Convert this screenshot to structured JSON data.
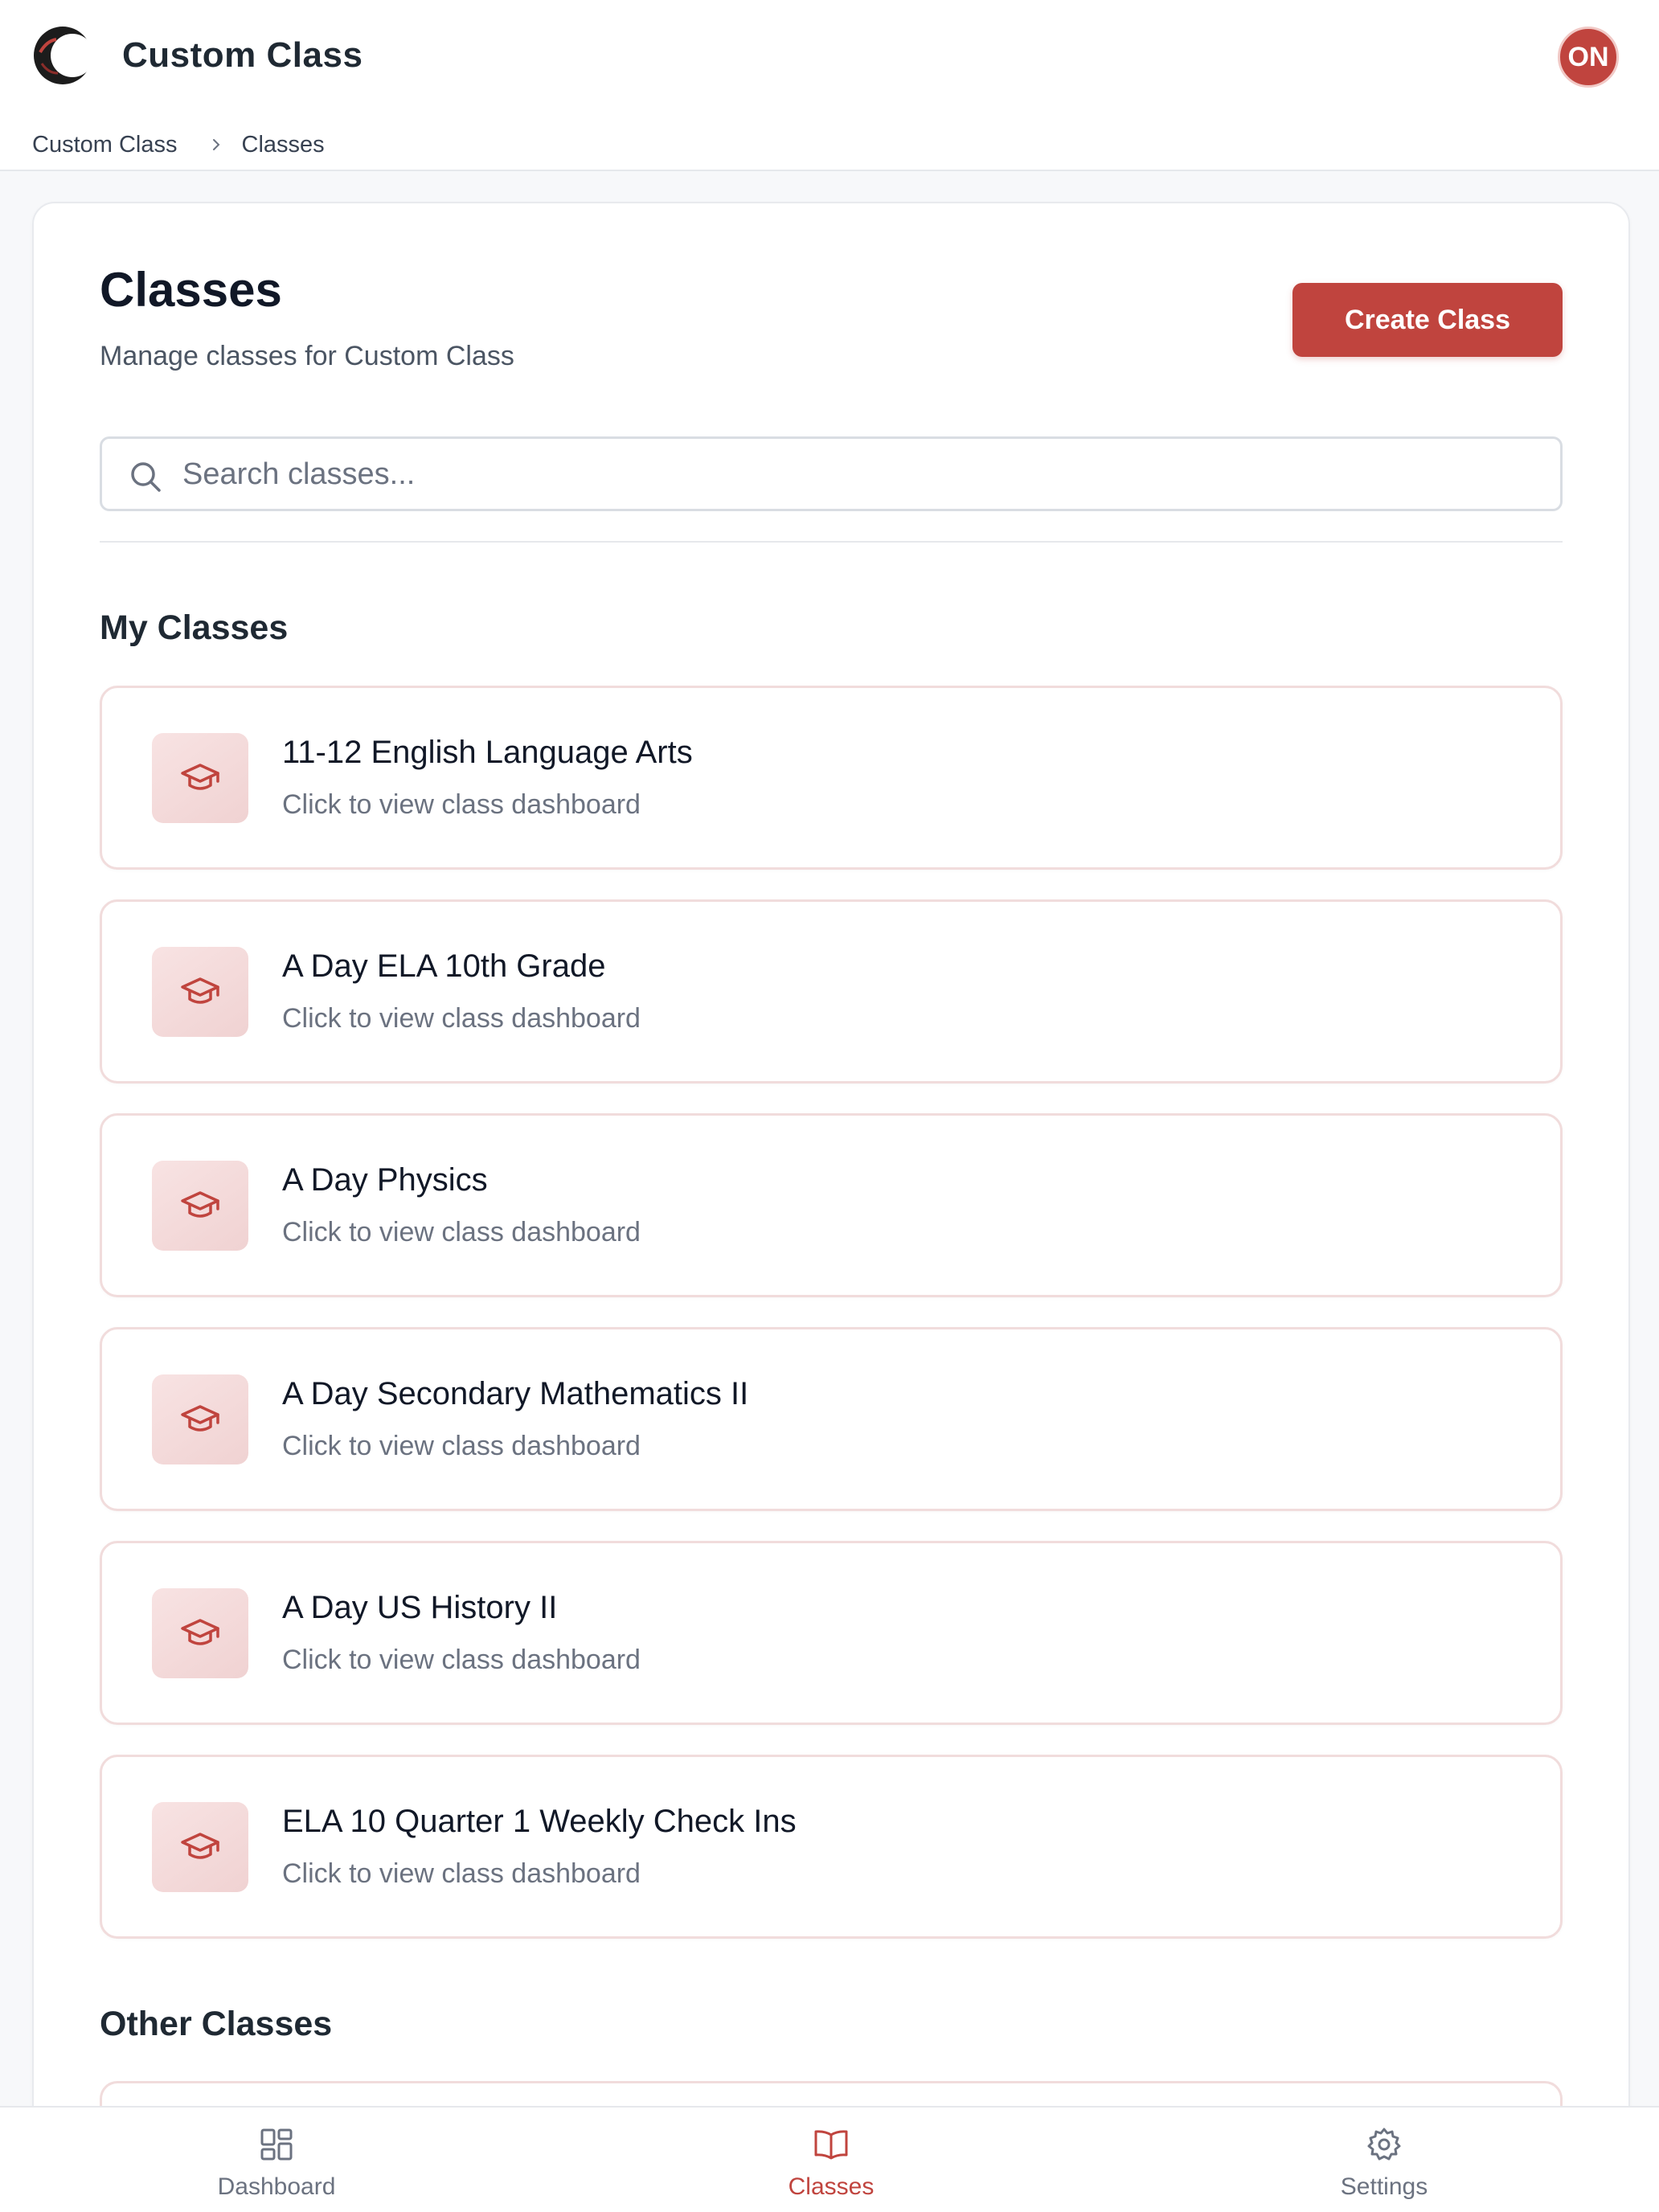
{
  "header": {
    "app_title": "Custom Class",
    "avatar_initials": "ON",
    "logo_icon": "crescent-logo",
    "avatar_color": "#c0443e",
    "breadcrumb": [
      "Custom Class",
      "Classes"
    ]
  },
  "page": {
    "title": "Classes",
    "subtitle": "Manage classes for Custom Class",
    "create_button": "Create Class",
    "search_placeholder": "Search classes..."
  },
  "sections": {
    "my_classes_title": "My Classes",
    "other_classes_title": "Other Classes"
  },
  "classes": [
    {
      "name": "11-12 English Language Arts",
      "subtitle": "Click to view class dashboard",
      "icon": "graduation-cap-icon"
    },
    {
      "name": "A Day ELA 10th Grade",
      "subtitle": "Click to view class dashboard",
      "icon": "graduation-cap-icon"
    },
    {
      "name": "A Day Physics",
      "subtitle": "Click to view class dashboard",
      "icon": "graduation-cap-icon"
    },
    {
      "name": "A Day Secondary Mathematics II",
      "subtitle": "Click to view class dashboard",
      "icon": "graduation-cap-icon"
    },
    {
      "name": "A Day US History II",
      "subtitle": "Click to view class dashboard",
      "icon": "graduation-cap-icon"
    },
    {
      "name": "ELA 10 Quarter 1 Weekly Check Ins",
      "subtitle": "Click to view class dashboard",
      "icon": "graduation-cap-icon"
    }
  ],
  "bottom_nav": [
    {
      "label": "Dashboard",
      "icon": "grid-icon",
      "active": false
    },
    {
      "label": "Classes",
      "icon": "book-icon",
      "active": true
    },
    {
      "label": "Settings",
      "icon": "gear-icon",
      "active": false
    }
  ],
  "colors": {
    "accent": "#c0443e",
    "card_border": "#f1dcdc",
    "icon_tile": "#f5dada",
    "muted_text": "#6b7280"
  }
}
